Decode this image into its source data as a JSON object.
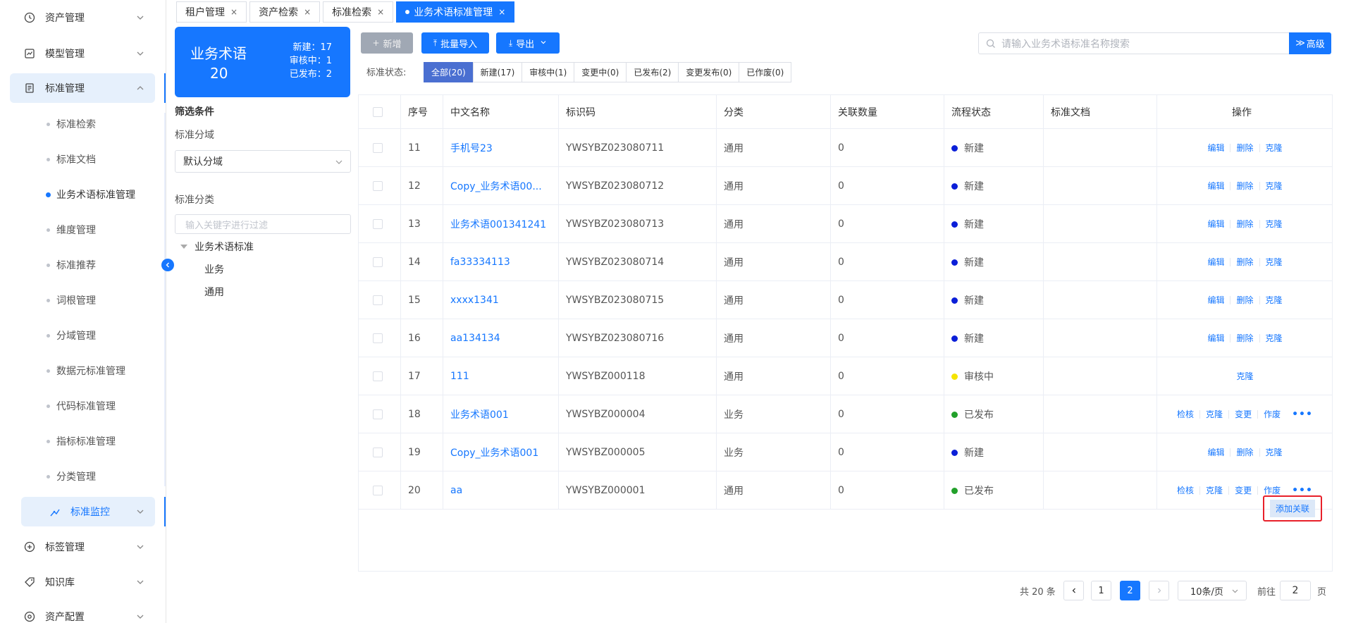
{
  "sidebar": {
    "items": [
      {
        "label": "资产管理",
        "icon": "clock-icon"
      },
      {
        "label": "模型管理",
        "icon": "chart-icon"
      },
      {
        "label": "标准管理",
        "icon": "document-icon"
      }
    ],
    "subitems": [
      "标准检索",
      "标准文档",
      "业务术语标准管理",
      "维度管理",
      "标准推荐",
      "词根管理",
      "分域管理",
      "数据元标准管理",
      "代码标准管理",
      "指标标准管理",
      "分类管理"
    ],
    "monitor": "标准监控",
    "bottom_items": [
      {
        "label": "标签管理",
        "icon": "plus-circle-icon"
      },
      {
        "label": "知识库",
        "icon": "tag-icon"
      },
      {
        "label": "资产配置",
        "icon": "settings-icon"
      }
    ]
  },
  "tabs": [
    "租户管理",
    "资产检索",
    "标准检索",
    "业务术语标准管理"
  ],
  "summary": {
    "title": "业务术语",
    "total": "20",
    "stats": [
      "新建：17",
      "审核中：1",
      "已发布：2"
    ]
  },
  "filter": {
    "heading": "筛选条件",
    "domain_label": "标准分域",
    "domain_value": "默认分域",
    "category_label": "标准分类",
    "category_placeholder": "输入关键字进行过滤",
    "tree_root": "业务术语标准",
    "tree_children": [
      "业务",
      "通用"
    ]
  },
  "toolbar": {
    "add": "新增",
    "import": "批量导入",
    "export": "导出",
    "search_placeholder": "请输入业务术语标准名称搜索",
    "advanced": "高级"
  },
  "status_filter": {
    "label": "标准状态:",
    "options": [
      "全部(20)",
      "新建(17)",
      "审核中(1)",
      "变更中(0)",
      "已发布(2)",
      "变更发布(0)",
      "已作废(0)"
    ]
  },
  "table": {
    "columns": [
      "序号",
      "中文名称",
      "标识码",
      "分类",
      "关联数量",
      "流程状态",
      "标准文档",
      "操作"
    ],
    "rows": [
      {
        "no": "11",
        "name": "手机号23",
        "code": "YWSYBZ023080711",
        "cat": "通用",
        "count": "0",
        "status": "新建",
        "color": "#0b1fd8",
        "ops": [
          "编辑",
          "删除",
          "克隆"
        ]
      },
      {
        "no": "12",
        "name": "Copy_业务术语00...",
        "code": "YWSYBZ023080712",
        "cat": "通用",
        "count": "0",
        "status": "新建",
        "color": "#0b1fd8",
        "ops": [
          "编辑",
          "删除",
          "克隆"
        ]
      },
      {
        "no": "13",
        "name": "业务术语001341241",
        "code": "YWSYBZ023080713",
        "cat": "通用",
        "count": "0",
        "status": "新建",
        "color": "#0b1fd8",
        "ops": [
          "编辑",
          "删除",
          "克隆"
        ]
      },
      {
        "no": "14",
        "name": "fa33334113",
        "code": "YWSYBZ023080714",
        "cat": "通用",
        "count": "0",
        "status": "新建",
        "color": "#0b1fd8",
        "ops": [
          "编辑",
          "删除",
          "克隆"
        ]
      },
      {
        "no": "15",
        "name": "xxxx1341",
        "code": "YWSYBZ023080715",
        "cat": "通用",
        "count": "0",
        "status": "新建",
        "color": "#0b1fd8",
        "ops": [
          "编辑",
          "删除",
          "克隆"
        ]
      },
      {
        "no": "16",
        "name": "aa134134",
        "code": "YWSYBZ023080716",
        "cat": "通用",
        "count": "0",
        "status": "新建",
        "color": "#0b1fd8",
        "ops": [
          "编辑",
          "删除",
          "克隆"
        ]
      },
      {
        "no": "17",
        "name": "111",
        "code": "YWSYBZ000118",
        "cat": "通用",
        "count": "0",
        "status": "审核中",
        "color": "#f5e400",
        "ops": [
          "克隆"
        ]
      },
      {
        "no": "18",
        "name": "业务术语001",
        "code": "YWSYBZ000004",
        "cat": "业务",
        "count": "0",
        "status": "已发布",
        "color": "#22a02a",
        "ops": [
          "检核",
          "克隆",
          "变更",
          "作废"
        ]
      },
      {
        "no": "19",
        "name": "Copy_业务术语001",
        "code": "YWSYBZ000005",
        "cat": "业务",
        "count": "0",
        "status": "新建",
        "color": "#0b1fd8",
        "ops": [
          "编辑",
          "删除",
          "克隆"
        ]
      },
      {
        "no": "20",
        "name": "aa",
        "code": "YWSYBZ000001",
        "cat": "通用",
        "count": "0",
        "status": "已发布",
        "color": "#22a02a",
        "ops": [
          "检核",
          "克隆",
          "变更",
          "作废"
        ]
      }
    ],
    "more": "•••",
    "tooltip": "添加关联"
  },
  "pagination": {
    "total": "共 20 条",
    "pages": [
      "1",
      "2"
    ],
    "size": "10条/页",
    "goto": "前往",
    "goto_value": "2",
    "page_suffix": "页"
  },
  "colors": {
    "primary": "#1677ff",
    "new": "#0b1fd8",
    "review": "#f5e400",
    "published": "#22a02a"
  }
}
